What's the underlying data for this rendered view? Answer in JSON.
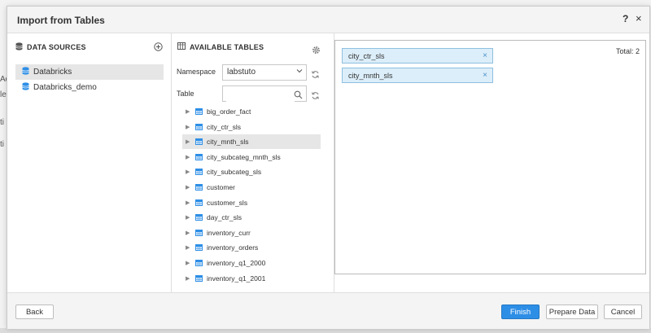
{
  "dialog": {
    "title": "Import from Tables",
    "help_label": "?",
    "close_label": "×"
  },
  "background": {
    "fragments": [
      "Ad",
      "le",
      "ti",
      "ti"
    ]
  },
  "data_sources": {
    "header": "DATA SOURCES",
    "items": [
      {
        "label": "Databricks",
        "selected": true
      },
      {
        "label": "Databricks_demo",
        "selected": false
      }
    ]
  },
  "available_tables": {
    "header": "AVAILABLE TABLES",
    "namespace_label": "Namespace",
    "namespace_value": "labstuto",
    "table_label": "Table",
    "table_search_value": "",
    "tables": [
      {
        "label": "big_order_fact",
        "selected": false
      },
      {
        "label": "city_ctr_sls",
        "selected": false
      },
      {
        "label": "city_mnth_sls",
        "selected": true
      },
      {
        "label": "city_subcateg_mnth_sls",
        "selected": false
      },
      {
        "label": "city_subcateg_sls",
        "selected": false
      },
      {
        "label": "customer",
        "selected": false
      },
      {
        "label": "customer_sls",
        "selected": false
      },
      {
        "label": "day_ctr_sls",
        "selected": false
      },
      {
        "label": "inventory_curr",
        "selected": false
      },
      {
        "label": "inventory_orders",
        "selected": false
      },
      {
        "label": "inventory_q1_2000",
        "selected": false
      },
      {
        "label": "inventory_q1_2001",
        "selected": false
      }
    ]
  },
  "selected_tables": {
    "total_label": "Total: 2",
    "items": [
      {
        "label": "city_ctr_sls",
        "remove": "×"
      },
      {
        "label": "city_mnth_sls",
        "remove": "×"
      }
    ]
  },
  "footer": {
    "back_label": "Back",
    "finish_label": "Finish",
    "prepare_label": "Prepare Data",
    "cancel_label": "Cancel"
  },
  "colors": {
    "accent": "#2d8ee6",
    "chip_bg": "#dceefa",
    "chip_border": "#8fbfe0",
    "selected_row": "#e6e6e6"
  },
  "icons": {
    "datasource": "database-icon",
    "add": "add-circle-icon",
    "tables": "table-icon",
    "settings": "gear-icon",
    "refresh": "refresh-icon",
    "search": "search-icon",
    "expand": "caret-right-icon",
    "remove": "close-icon"
  }
}
